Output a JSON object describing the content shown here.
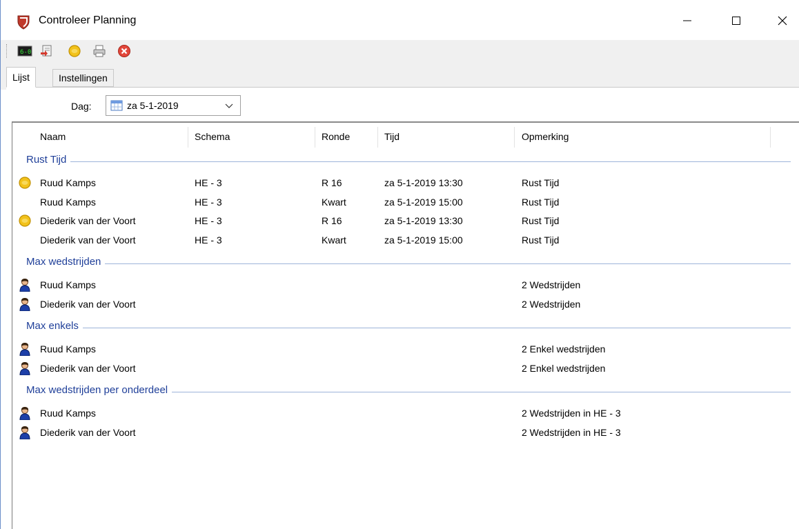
{
  "window": {
    "title": "Controleer Planning",
    "controls": {
      "minimize": "–",
      "maximize": "☐",
      "close": "✕"
    }
  },
  "toolbar": {
    "buttons": [
      {
        "icon": "scoreboard-icon"
      },
      {
        "icon": "export-icon"
      },
      {
        "icon": "coin-icon"
      },
      {
        "icon": "printer-icon"
      },
      {
        "icon": "close-red-icon"
      }
    ]
  },
  "tabs": [
    {
      "label": "Lijst",
      "active": true
    },
    {
      "label": "Instellingen",
      "active": false
    }
  ],
  "filter": {
    "day_label": "Dag:",
    "day_value": "za 5-1-2019"
  },
  "columns": [
    "Naam",
    "Schema",
    "Ronde",
    "Tijd",
    "Opmerking"
  ],
  "groups": [
    {
      "title": "Rust Tijd",
      "rows": [
        {
          "icon": "coin-icon",
          "naam": "Ruud Kamps",
          "schema": "HE - 3",
          "ronde": "R 16",
          "tijd": "za 5-1-2019 13:30",
          "opmerking": "Rust Tijd"
        },
        {
          "icon": "",
          "naam": "Ruud Kamps",
          "schema": "HE - 3",
          "ronde": "Kwart",
          "tijd": "za 5-1-2019 15:00",
          "opmerking": "Rust Tijd"
        },
        {
          "icon": "coin-icon",
          "naam": "Diederik van der Voort",
          "schema": "HE - 3",
          "ronde": "R 16",
          "tijd": "za 5-1-2019 13:30",
          "opmerking": "Rust Tijd"
        },
        {
          "icon": "",
          "naam": "Diederik van der Voort",
          "schema": "HE - 3",
          "ronde": "Kwart",
          "tijd": "za 5-1-2019 15:00",
          "opmerking": "Rust Tijd"
        }
      ]
    },
    {
      "title": "Max wedstrijden",
      "rows": [
        {
          "icon": "person-icon",
          "naam": "Ruud Kamps",
          "schema": "",
          "ronde": "",
          "tijd": "",
          "opmerking": "2 Wedstrijden"
        },
        {
          "icon": "person-icon",
          "naam": "Diederik van der Voort",
          "schema": "",
          "ronde": "",
          "tijd": "",
          "opmerking": "2 Wedstrijden"
        }
      ]
    },
    {
      "title": "Max enkels",
      "rows": [
        {
          "icon": "person-icon",
          "naam": "Ruud Kamps",
          "schema": "",
          "ronde": "",
          "tijd": "",
          "opmerking": "2 Enkel wedstrijden"
        },
        {
          "icon": "person-icon",
          "naam": "Diederik van der Voort",
          "schema": "",
          "ronde": "",
          "tijd": "",
          "opmerking": "2 Enkel wedstrijden"
        }
      ]
    },
    {
      "title": "Max wedstrijden per onderdeel",
      "rows": [
        {
          "icon": "person-icon",
          "naam": "Ruud Kamps",
          "schema": "",
          "ronde": "",
          "tijd": "",
          "opmerking": "2 Wedstrijden in HE - 3"
        },
        {
          "icon": "person-icon",
          "naam": "Diederik van der Voort",
          "schema": "",
          "ronde": "",
          "tijd": "",
          "opmerking": "2 Wedstrijden in HE - 3"
        }
      ]
    }
  ],
  "colors": {
    "group_title": "#1f3f99",
    "group_line": "#9db3d9",
    "coin": "#f2c21b",
    "person_body": "#1d3fa8"
  }
}
